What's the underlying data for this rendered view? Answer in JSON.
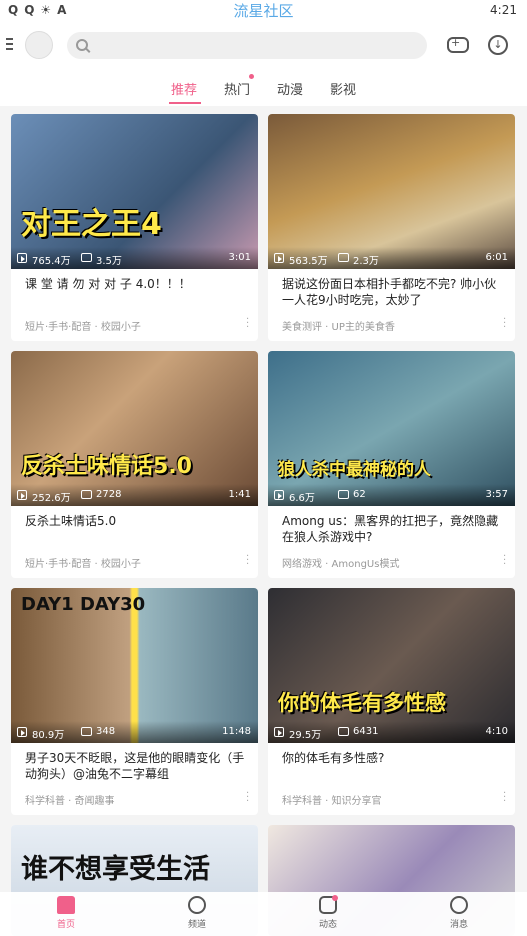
{
  "status": {
    "title": "流星社区",
    "time": "4:21",
    "icons": [
      "Q",
      "Q",
      "☀",
      "A"
    ]
  },
  "header": {
    "search_placeholder": "",
    "icons": [
      "menu-icon",
      "avatar",
      "search-icon",
      "gamepad-icon",
      "download-icon"
    ]
  },
  "tabs": [
    {
      "label": "推荐",
      "active": true
    },
    {
      "label": "热门",
      "badge": true
    },
    {
      "label": "动漫"
    },
    {
      "label": "影视"
    }
  ],
  "colors": {
    "accent": "#f0608a",
    "brand_title": "#5aa9e6"
  },
  "cards": [
    {
      "overlay": "对王之王4",
      "plays": "765.4万",
      "danmu": "3.5万",
      "duration": "3:01",
      "title": "课 堂 请 勿 对 对 子 4.0！！！",
      "sub": "短片·手书·配音 · 校园小子"
    },
    {
      "overlay": "",
      "plays": "563.5万",
      "danmu": "2.3万",
      "duration": "6:01",
      "title": "据说这份面日本相扑手都吃不完? 帅小伙一人花9小时吃完，太妙了",
      "sub": "美食测评 · UP主的美食香"
    },
    {
      "overlay": "反杀土味情话5.0",
      "plays": "252.6万",
      "danmu": "2728",
      "duration": "1:41",
      "title": "反杀土味情话5.0",
      "sub": "短片·手书·配音 · 校园小子"
    },
    {
      "overlay": "狼人杀中最神秘的人",
      "plays": "6.6万",
      "danmu": "62",
      "duration": "3:57",
      "title": "Among us：黑客界的扛把子，竟然隐藏在狼人杀游戏中?",
      "sub": "网络游戏 · AmongUs模式"
    },
    {
      "overlay": "DAY1 DAY30",
      "plays": "80.9万",
      "danmu": "348",
      "duration": "11:48",
      "title": "男子30天不眨眼，这是他的眼睛变化（手动狗头）@油兔不二字幕组",
      "sub": "科学科普 · 奇闻趣事"
    },
    {
      "overlay": "你的体毛有多性感",
      "plays": "29.5万",
      "danmu": "6431",
      "duration": "4:10",
      "title": "你的体毛有多性感?",
      "sub": "科学科普 · 知识分享官"
    },
    {
      "overlay": "谁不想享受生活",
      "plays": "",
      "danmu": "",
      "duration": "",
      "title": "",
      "sub": ""
    },
    {
      "overlay": "",
      "plays": "",
      "danmu": "",
      "duration": "",
      "title": "",
      "sub": ""
    }
  ],
  "bottom_nav": [
    {
      "label": "首页",
      "icon": "home-icon",
      "active": true
    },
    {
      "label": "频道",
      "icon": "channel-icon"
    },
    {
      "label": "动态",
      "icon": "dynamic-icon",
      "badge": true
    },
    {
      "label": "消息",
      "icon": "message-icon"
    }
  ]
}
